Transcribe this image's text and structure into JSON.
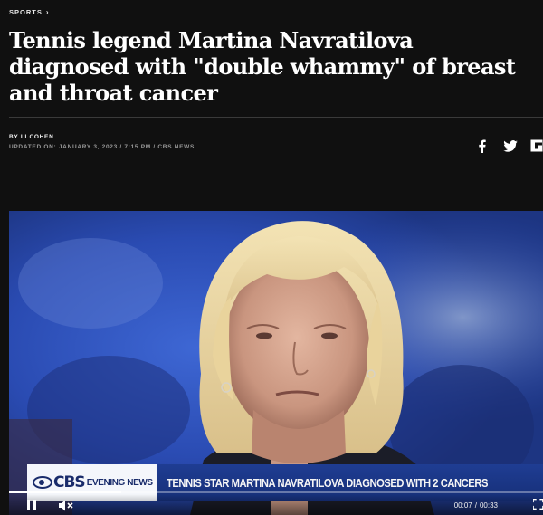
{
  "breadcrumb": {
    "section": "SPORTS",
    "chevron": "›"
  },
  "headline": "Tennis legend Martina Navratilova diagnosed with \"double whammy\" of breast and throat cancer",
  "byline": "BY LI COHEN",
  "dateline": "UPDATED ON: JANUARY 3, 2023 / 7:15 PM / CBS NEWS",
  "share": {
    "icons": [
      "facebook-icon",
      "twitter-icon",
      "flipboard-icon"
    ]
  },
  "video": {
    "lower_third": {
      "network": "CBS",
      "show": "EVENING NEWS",
      "headline": "TENNIS STAR MARTINA NAVRATILOVA DIAGNOSED WITH 2 CANCERS"
    },
    "current_time": "00:07",
    "separator": "/",
    "duration": "00:33",
    "progress": 0.21,
    "icons": [
      "pause-icon",
      "mute-icon",
      "fullscreen-icon"
    ]
  },
  "colors": {
    "background": "#101010",
    "lower_third_blue": "#1f3d93",
    "cbs_navy": "#1a2c6b"
  }
}
